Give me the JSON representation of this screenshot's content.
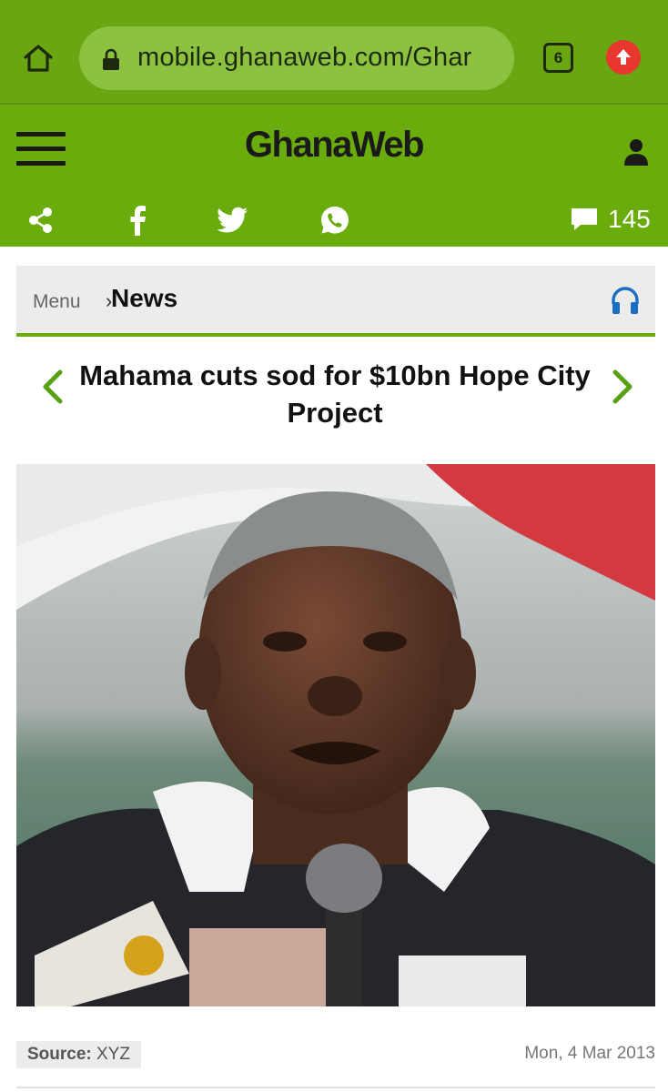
{
  "browser": {
    "url": "mobile.ghanaweb.com/Ghar",
    "tab_count": "6"
  },
  "site": {
    "logo": "GhanaWeb",
    "comment_count": "145"
  },
  "breadcrumb": {
    "menu": "Menu",
    "separator": "›",
    "section": "News"
  },
  "article": {
    "title": "Mahama cuts sod for $10bn Hope City Project",
    "source_label": "Source:",
    "source_value": "XYZ",
    "date": "Mon, 4 Mar 2013"
  },
  "colors": {
    "browser_bar": "#6aa612",
    "header_green": "#6aac0c",
    "accent_green": "#5aa014",
    "headphones_blue": "#1a6fc4"
  },
  "icons": [
    "home-icon",
    "lock-icon",
    "tabs-icon",
    "update-icon",
    "hamburger-icon",
    "user-icon",
    "share-icon",
    "facebook-icon",
    "twitter-icon",
    "whatsapp-icon",
    "comment-icon",
    "headphones-icon",
    "chevron-left-icon",
    "chevron-right-icon"
  ]
}
